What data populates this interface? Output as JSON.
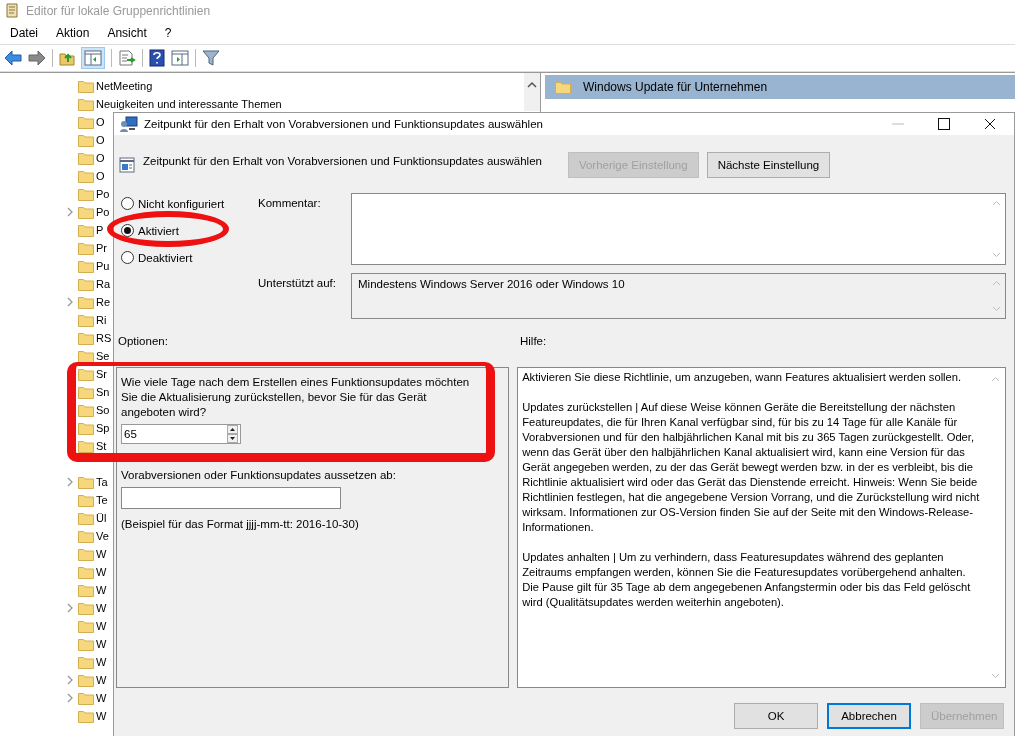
{
  "window": {
    "title": "Editor für lokale Gruppenrichtlinien"
  },
  "menu": [
    "Datei",
    "Aktion",
    "Ansicht",
    "?"
  ],
  "tree": {
    "items": [
      {
        "label": "NetMeeting",
        "has_children": false
      },
      {
        "label": "Neuigkeiten und interessante Themen",
        "has_children": false
      },
      {
        "label": "O",
        "has_children": false
      },
      {
        "label": "O",
        "has_children": false
      },
      {
        "label": "O",
        "has_children": false
      },
      {
        "label": "O",
        "has_children": false
      },
      {
        "label": "Po",
        "has_children": false
      },
      {
        "label": "Po",
        "has_children": true
      },
      {
        "label": "P",
        "has_children": false
      },
      {
        "label": "Pr",
        "has_children": false
      },
      {
        "label": "Pu",
        "has_children": false
      },
      {
        "label": "Ra",
        "has_children": false
      },
      {
        "label": "Re",
        "has_children": true
      },
      {
        "label": "Ri",
        "has_children": false
      },
      {
        "label": "RS",
        "has_children": false
      },
      {
        "label": "Se",
        "has_children": false
      },
      {
        "label": "Sr"
      },
      {
        "label": "Sn"
      },
      {
        "label": "So"
      },
      {
        "label": "Sp"
      },
      {
        "label": "St"
      },
      {
        "label": "Ta",
        "has_children": true
      },
      {
        "label": "Te",
        "has_children": false
      },
      {
        "label": "Ül",
        "has_children": false
      },
      {
        "label": "Ve",
        "has_children": false
      },
      {
        "label": "W",
        "has_children": false
      },
      {
        "label": "W",
        "has_children": false
      },
      {
        "label": "W",
        "has_children": false
      },
      {
        "label": "W",
        "has_children": true
      },
      {
        "label": "W",
        "has_children": false
      },
      {
        "label": "W",
        "has_children": false
      },
      {
        "label": "W",
        "has_children": false
      },
      {
        "label": "W",
        "has_children": true
      },
      {
        "label": "W",
        "has_children": true
      },
      {
        "label": "W",
        "has_children": false
      }
    ]
  },
  "details": {
    "header": "Windows Update für Unternehmen"
  },
  "dialog": {
    "title": "Zeitpunkt für den Erhalt von Vorabversionen und Funktionsupdates auswählen",
    "policy_title": "Zeitpunkt für den Erhalt von Vorabversionen und Funktionsupdates auswählen",
    "nav_buttons": [
      {
        "label": "Vorherige Einstellung",
        "disabled": true
      },
      {
        "label": "Nächste Einstellung",
        "disabled": false
      }
    ],
    "states": [
      {
        "label": "Nicht konfiguriert",
        "selected": false
      },
      {
        "label": "Aktiviert",
        "selected": true
      },
      {
        "label": "Deaktiviert",
        "selected": false
      }
    ],
    "comment": {
      "label": "Kommentar:"
    },
    "supported": {
      "label": "Unterstützt auf:",
      "value": "Mindestens Windows Server 2016 oder Windows 10"
    },
    "options_label": "Optionen:",
    "help_label": "Hilfe:",
    "options": [
      {
        "kind": "spin",
        "label": "Wie viele Tage nach dem Erstellen eines Funktionsupdates möchten Sie die Aktualisierung zurückstellen, bevor Sie für das Gerät angeboten wird?",
        "value": "65"
      },
      {
        "kind": "date",
        "label": "Vorabversionen oder Funktionsupdates aussetzen ab:",
        "hint": "(Beispiel für das Format jjjj-mm-tt: 2016-10-30)"
      }
    ],
    "help_paragraphs": [
      "Aktivieren Sie diese Richtlinie, um anzugeben, wann Features aktualisiert werden sollen.",
      "Updates zurückstellen | Auf diese Weise können Geräte die Bereitstellung der nächsten Featureupdates, die für Ihren Kanal verfügbar sind, für bis zu 14 Tage für alle Kanäle für Vorabversionen und für den halbjährlichen Kanal mit bis zu 365 Tagen zurückgestellt. Oder, wenn das Gerät über den halbjährlichen Kanal aktualisiert wird, kann eine Version für das Gerät angegeben werden, zu der das Gerät bewegt werden bzw. in der es verbleibt, bis die Richtlinie aktualisiert wird oder das Gerät das Dienstende erreicht. Hinweis: Wenn Sie beide Richtlinien festlegen, hat die angegebene Version Vorrang, und die Zurückstellung wird nicht wirksam. Informationen zur OS-Version finden Sie auf der Seite mit den Windows-Release-Informationen.",
      "Updates anhalten | Um zu verhindern, dass Featuresupdates während des geplanten Zeitraums empfangen werden, können Sie die Featuresupdates vorübergehend anhalten. Die Pause gilt für 35 Tage ab dem angegebenen Anfangstermin oder bis das Feld gelöscht wird (Qualitätsupdates werden weiterhin angeboten)."
    ],
    "footer_buttons": [
      {
        "label": "OK",
        "disabled": false,
        "focused": false
      },
      {
        "label": "Abbrechen",
        "disabled": false,
        "focused": true
      },
      {
        "label": "Übernehmen",
        "disabled": true,
        "focused": false
      }
    ]
  },
  "annotations": [
    {
      "kind": "ellipse"
    },
    {
      "kind": "rectangle"
    }
  ]
}
